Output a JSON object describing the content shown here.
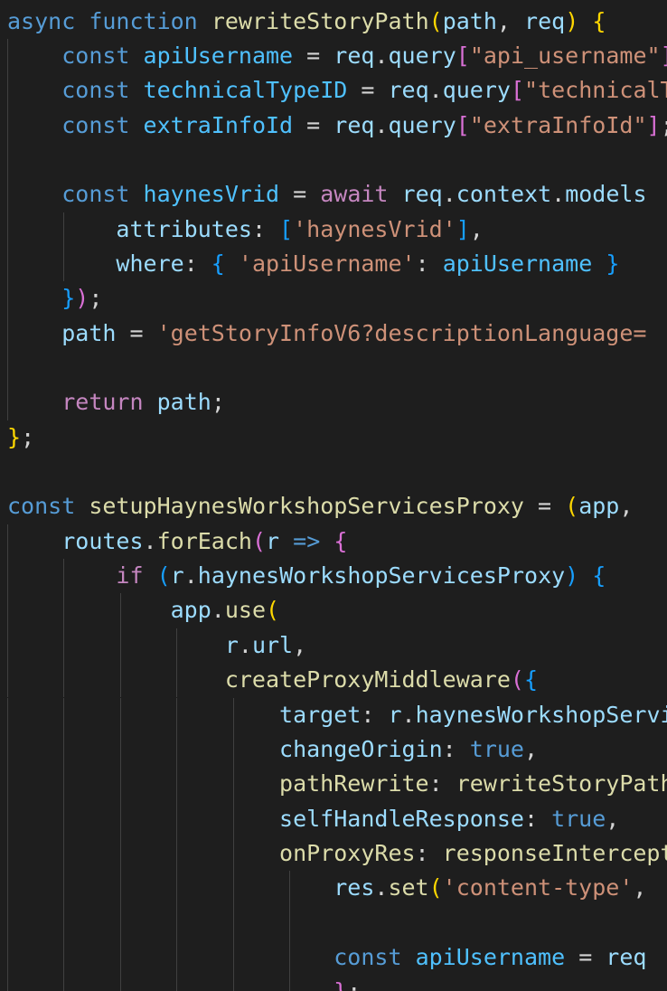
{
  "editor": {
    "language": "javascript",
    "theme": "dark",
    "colors": {
      "background": "#1e1e1e",
      "keyword": "#569cd6",
      "control": "#c586c0",
      "function": "#dcdcaa",
      "variable": "#9cdcfe",
      "constant": "#4fc1ff",
      "string": "#ce9178",
      "punctuation": "#d4d4d4",
      "bracket_level1": "#ffd700",
      "bracket_level2": "#da70d6",
      "bracket_level3": "#179fff"
    },
    "lines": [
      {
        "tokens": [
          [
            "kw",
            "async"
          ],
          [
            "p",
            " "
          ],
          [
            "kw",
            "function"
          ],
          [
            "p",
            " "
          ],
          [
            "fn",
            "rewriteStoryPath"
          ],
          [
            "b1",
            "("
          ],
          [
            "var",
            "path"
          ],
          [
            "p",
            ", "
          ],
          [
            "var",
            "req"
          ],
          [
            "b1",
            ")"
          ],
          [
            "p",
            " "
          ],
          [
            "b1",
            "{"
          ]
        ]
      },
      {
        "tokens": [
          [
            "p",
            "    "
          ],
          [
            "kw",
            "const"
          ],
          [
            "p",
            " "
          ],
          [
            "cst",
            "apiUsername"
          ],
          [
            "p",
            " = "
          ],
          [
            "var",
            "req"
          ],
          [
            "p",
            "."
          ],
          [
            "prop",
            "query"
          ],
          [
            "b2",
            "["
          ],
          [
            "str",
            "\"api_username\""
          ],
          [
            "b2",
            "]"
          ],
          [
            "p",
            ";"
          ]
        ]
      },
      {
        "tokens": [
          [
            "p",
            "    "
          ],
          [
            "kw",
            "const"
          ],
          [
            "p",
            " "
          ],
          [
            "cst",
            "technicalTypeID"
          ],
          [
            "p",
            " = "
          ],
          [
            "var",
            "req"
          ],
          [
            "p",
            "."
          ],
          [
            "prop",
            "query"
          ],
          [
            "b2",
            "["
          ],
          [
            "str",
            "\"technicalTypeID\""
          ],
          [
            "b2",
            "]"
          ],
          [
            "p",
            ";"
          ]
        ]
      },
      {
        "tokens": [
          [
            "p",
            "    "
          ],
          [
            "kw",
            "const"
          ],
          [
            "p",
            " "
          ],
          [
            "cst",
            "extraInfoId"
          ],
          [
            "p",
            " = "
          ],
          [
            "var",
            "req"
          ],
          [
            "p",
            "."
          ],
          [
            "prop",
            "query"
          ],
          [
            "b2",
            "["
          ],
          [
            "str",
            "\"extraInfoId\""
          ],
          [
            "b2",
            "]"
          ],
          [
            "p",
            ";"
          ]
        ]
      },
      {
        "tokens": []
      },
      {
        "tokens": [
          [
            "p",
            "    "
          ],
          [
            "kw",
            "const"
          ],
          [
            "p",
            " "
          ],
          [
            "cst",
            "haynesVrid"
          ],
          [
            "p",
            " = "
          ],
          [
            "ctl",
            "await"
          ],
          [
            "p",
            " "
          ],
          [
            "var",
            "req"
          ],
          [
            "p",
            "."
          ],
          [
            "prop",
            "context"
          ],
          [
            "p",
            "."
          ],
          [
            "prop",
            "models"
          ]
        ]
      },
      {
        "tokens": [
          [
            "p",
            "        "
          ],
          [
            "prop",
            "attributes"
          ],
          [
            "p",
            ": "
          ],
          [
            "b3",
            "["
          ],
          [
            "str",
            "'haynesVrid'"
          ],
          [
            "b3",
            "]"
          ],
          [
            "p",
            ","
          ]
        ]
      },
      {
        "tokens": [
          [
            "p",
            "        "
          ],
          [
            "prop",
            "where"
          ],
          [
            "p",
            ": "
          ],
          [
            "b3",
            "{"
          ],
          [
            "p",
            " "
          ],
          [
            "str",
            "'apiUsername'"
          ],
          [
            "p",
            ": "
          ],
          [
            "cst",
            "apiUsername"
          ],
          [
            "p",
            " "
          ],
          [
            "b3",
            "}"
          ]
        ]
      },
      {
        "tokens": [
          [
            "p",
            "    "
          ],
          [
            "b3",
            "}"
          ],
          [
            "b2",
            ")"
          ],
          [
            "p",
            ";"
          ]
        ]
      },
      {
        "tokens": [
          [
            "p",
            "    "
          ],
          [
            "var",
            "path"
          ],
          [
            "p",
            " = "
          ],
          [
            "str",
            "'getStoryInfoV6?descriptionLanguage="
          ]
        ]
      },
      {
        "tokens": []
      },
      {
        "tokens": [
          [
            "p",
            "    "
          ],
          [
            "ctl",
            "return"
          ],
          [
            "p",
            " "
          ],
          [
            "var",
            "path"
          ],
          [
            "p",
            ";"
          ]
        ]
      },
      {
        "tokens": [
          [
            "b1",
            "}"
          ],
          [
            "p",
            ";"
          ]
        ]
      },
      {
        "tokens": []
      },
      {
        "tokens": [
          [
            "kw",
            "const"
          ],
          [
            "p",
            " "
          ],
          [
            "fn",
            "setupHaynesWorkshopServicesProxy"
          ],
          [
            "p",
            " = "
          ],
          [
            "b1",
            "("
          ],
          [
            "var",
            "app"
          ],
          [
            "p",
            ", "
          ]
        ]
      },
      {
        "tokens": [
          [
            "p",
            "    "
          ],
          [
            "var",
            "routes"
          ],
          [
            "p",
            "."
          ],
          [
            "fn",
            "forEach"
          ],
          [
            "b2",
            "("
          ],
          [
            "var",
            "r"
          ],
          [
            "p",
            " "
          ],
          [
            "kw",
            "=>"
          ],
          [
            "p",
            " "
          ],
          [
            "b2",
            "{"
          ]
        ]
      },
      {
        "tokens": [
          [
            "p",
            "        "
          ],
          [
            "ctl",
            "if"
          ],
          [
            "p",
            " "
          ],
          [
            "b3",
            "("
          ],
          [
            "var",
            "r"
          ],
          [
            "p",
            "."
          ],
          [
            "prop",
            "haynesWorkshopServicesProxy"
          ],
          [
            "b3",
            ")"
          ],
          [
            "p",
            " "
          ],
          [
            "b3",
            "{"
          ]
        ]
      },
      {
        "tokens": [
          [
            "p",
            "            "
          ],
          [
            "var",
            "app"
          ],
          [
            "p",
            "."
          ],
          [
            "fn",
            "use"
          ],
          [
            "b1",
            "("
          ]
        ]
      },
      {
        "tokens": [
          [
            "p",
            "                "
          ],
          [
            "var",
            "r"
          ],
          [
            "p",
            "."
          ],
          [
            "prop",
            "url"
          ],
          [
            "p",
            ","
          ]
        ]
      },
      {
        "tokens": [
          [
            "p",
            "                "
          ],
          [
            "fn",
            "createProxyMiddleware"
          ],
          [
            "b2",
            "("
          ],
          [
            "b3",
            "{"
          ]
        ]
      },
      {
        "tokens": [
          [
            "p",
            "                    "
          ],
          [
            "prop",
            "target"
          ],
          [
            "p",
            ": "
          ],
          [
            "var",
            "r"
          ],
          [
            "p",
            "."
          ],
          [
            "prop",
            "haynesWorkshopServicesUrl"
          ]
        ]
      },
      {
        "tokens": [
          [
            "p",
            "                    "
          ],
          [
            "prop",
            "changeOrigin"
          ],
          [
            "p",
            ": "
          ],
          [
            "bool",
            "true"
          ],
          [
            "p",
            ","
          ]
        ]
      },
      {
        "tokens": [
          [
            "p",
            "                    "
          ],
          [
            "fn",
            "pathRewrite"
          ],
          [
            "p",
            ": "
          ],
          [
            "fn",
            "rewriteStoryPath"
          ],
          [
            "p",
            ","
          ]
        ]
      },
      {
        "tokens": [
          [
            "p",
            "                    "
          ],
          [
            "prop",
            "selfHandleResponse"
          ],
          [
            "p",
            ": "
          ],
          [
            "bool",
            "true"
          ],
          [
            "p",
            ","
          ]
        ]
      },
      {
        "tokens": [
          [
            "p",
            "                    "
          ],
          [
            "fn",
            "onProxyRes"
          ],
          [
            "p",
            ": "
          ],
          [
            "fn",
            "responseInterceptor"
          ]
        ]
      },
      {
        "tokens": [
          [
            "p",
            "                        "
          ],
          [
            "var",
            "res"
          ],
          [
            "p",
            "."
          ],
          [
            "fn",
            "set"
          ],
          [
            "b1",
            "("
          ],
          [
            "str",
            "'content-type'"
          ],
          [
            "p",
            ", "
          ]
        ]
      },
      {
        "tokens": []
      },
      {
        "tokens": [
          [
            "p",
            "                        "
          ],
          [
            "kw",
            "const"
          ],
          [
            "p",
            " "
          ],
          [
            "cst",
            "apiUsername"
          ],
          [
            "p",
            " = "
          ],
          [
            "var",
            "req"
          ]
        ]
      },
      {
        "tokens": [
          [
            "p",
            "                        "
          ],
          [
            "b2",
            "}"
          ],
          [
            "p",
            ";"
          ]
        ]
      }
    ]
  }
}
